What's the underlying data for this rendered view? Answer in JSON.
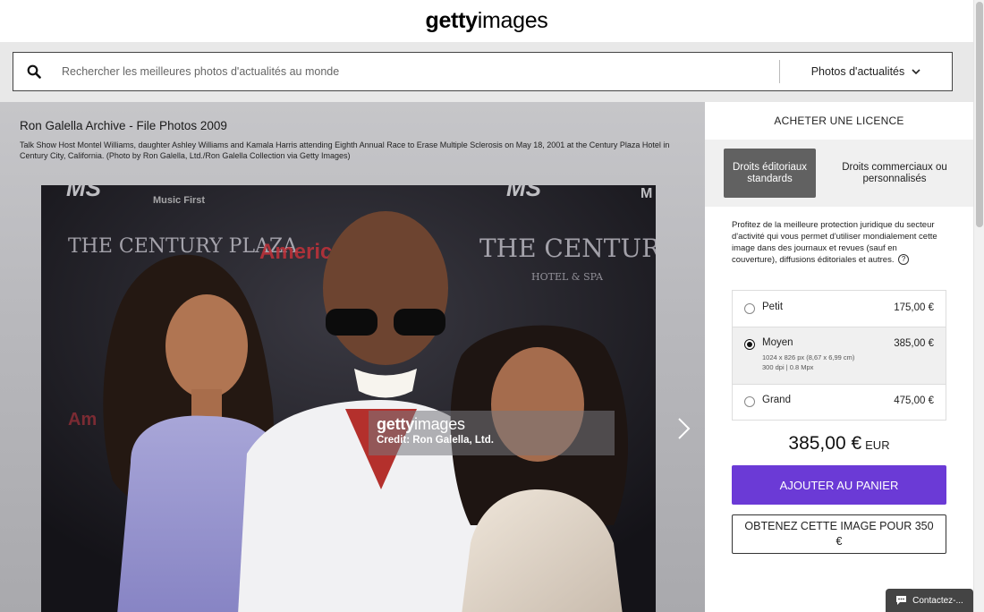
{
  "header": {
    "logo_bold": "getty",
    "logo_light": "images"
  },
  "search": {
    "placeholder": "Rechercher les meilleures photos d'actualités au monde",
    "type_label": "Photos d'actualités"
  },
  "image": {
    "title": "Ron Galella Archive - File Photos 2009",
    "caption": "Talk Show Host Montel Williams, daughter Ashley Williams and Kamala Harris attending Eighth Annual Race to Erase Multiple Sclerosis on May 18, 2001 at the Century Plaza Hotel in Century City, California. (Photo by Ron Galella, Ltd./Ron Galella Collection via Getty Images)",
    "watermark_bold": "getty",
    "watermark_light": "images",
    "credit": "Credit: Ron Galella, Ltd.",
    "backdrop_text": {
      "century_plaza_1": "THE CENTURY PLAZA",
      "century_plaza_2": "THE CENTURY PL",
      "hotel_spa": "HOTEL & SPA",
      "american": "American",
      "music_first": "Music First",
      "ms_1": "MS",
      "ms_2": "MS",
      "m": "M",
      "am": "Am"
    }
  },
  "license": {
    "heading": "ACHETER UNE LICENCE",
    "tab_standard": "Droits éditoriaux standards",
    "tab_commercial": "Droits commerciaux ou personnalisés",
    "description": "Profitez de la meilleure protection juridique du secteur d'activité qui vous permet d'utiliser mondialement cette image dans des journaux et revues (sauf en couverture), diffusions éditoriales et autres.",
    "sizes": [
      {
        "name": "Petit",
        "price": "175,00 €",
        "selected": false
      },
      {
        "name": "Moyen",
        "price": "385,00 €",
        "detail_1": "1024 x 826 px (8,67 x 6,99 cm)",
        "detail_2": "300 dpi | 0.8 Mpx",
        "selected": true
      },
      {
        "name": "Grand",
        "price": "475,00 €",
        "selected": false
      }
    ],
    "total_price": "385,00 €",
    "currency": "EUR",
    "add_to_cart": "AJOUTER AU PANIER",
    "get_image": "OBTENEZ CETTE IMAGE POUR 350 €"
  },
  "contact": {
    "label": "Contactez-..."
  },
  "colors": {
    "accent": "#6b3ad6",
    "tab_active": "#616161"
  }
}
